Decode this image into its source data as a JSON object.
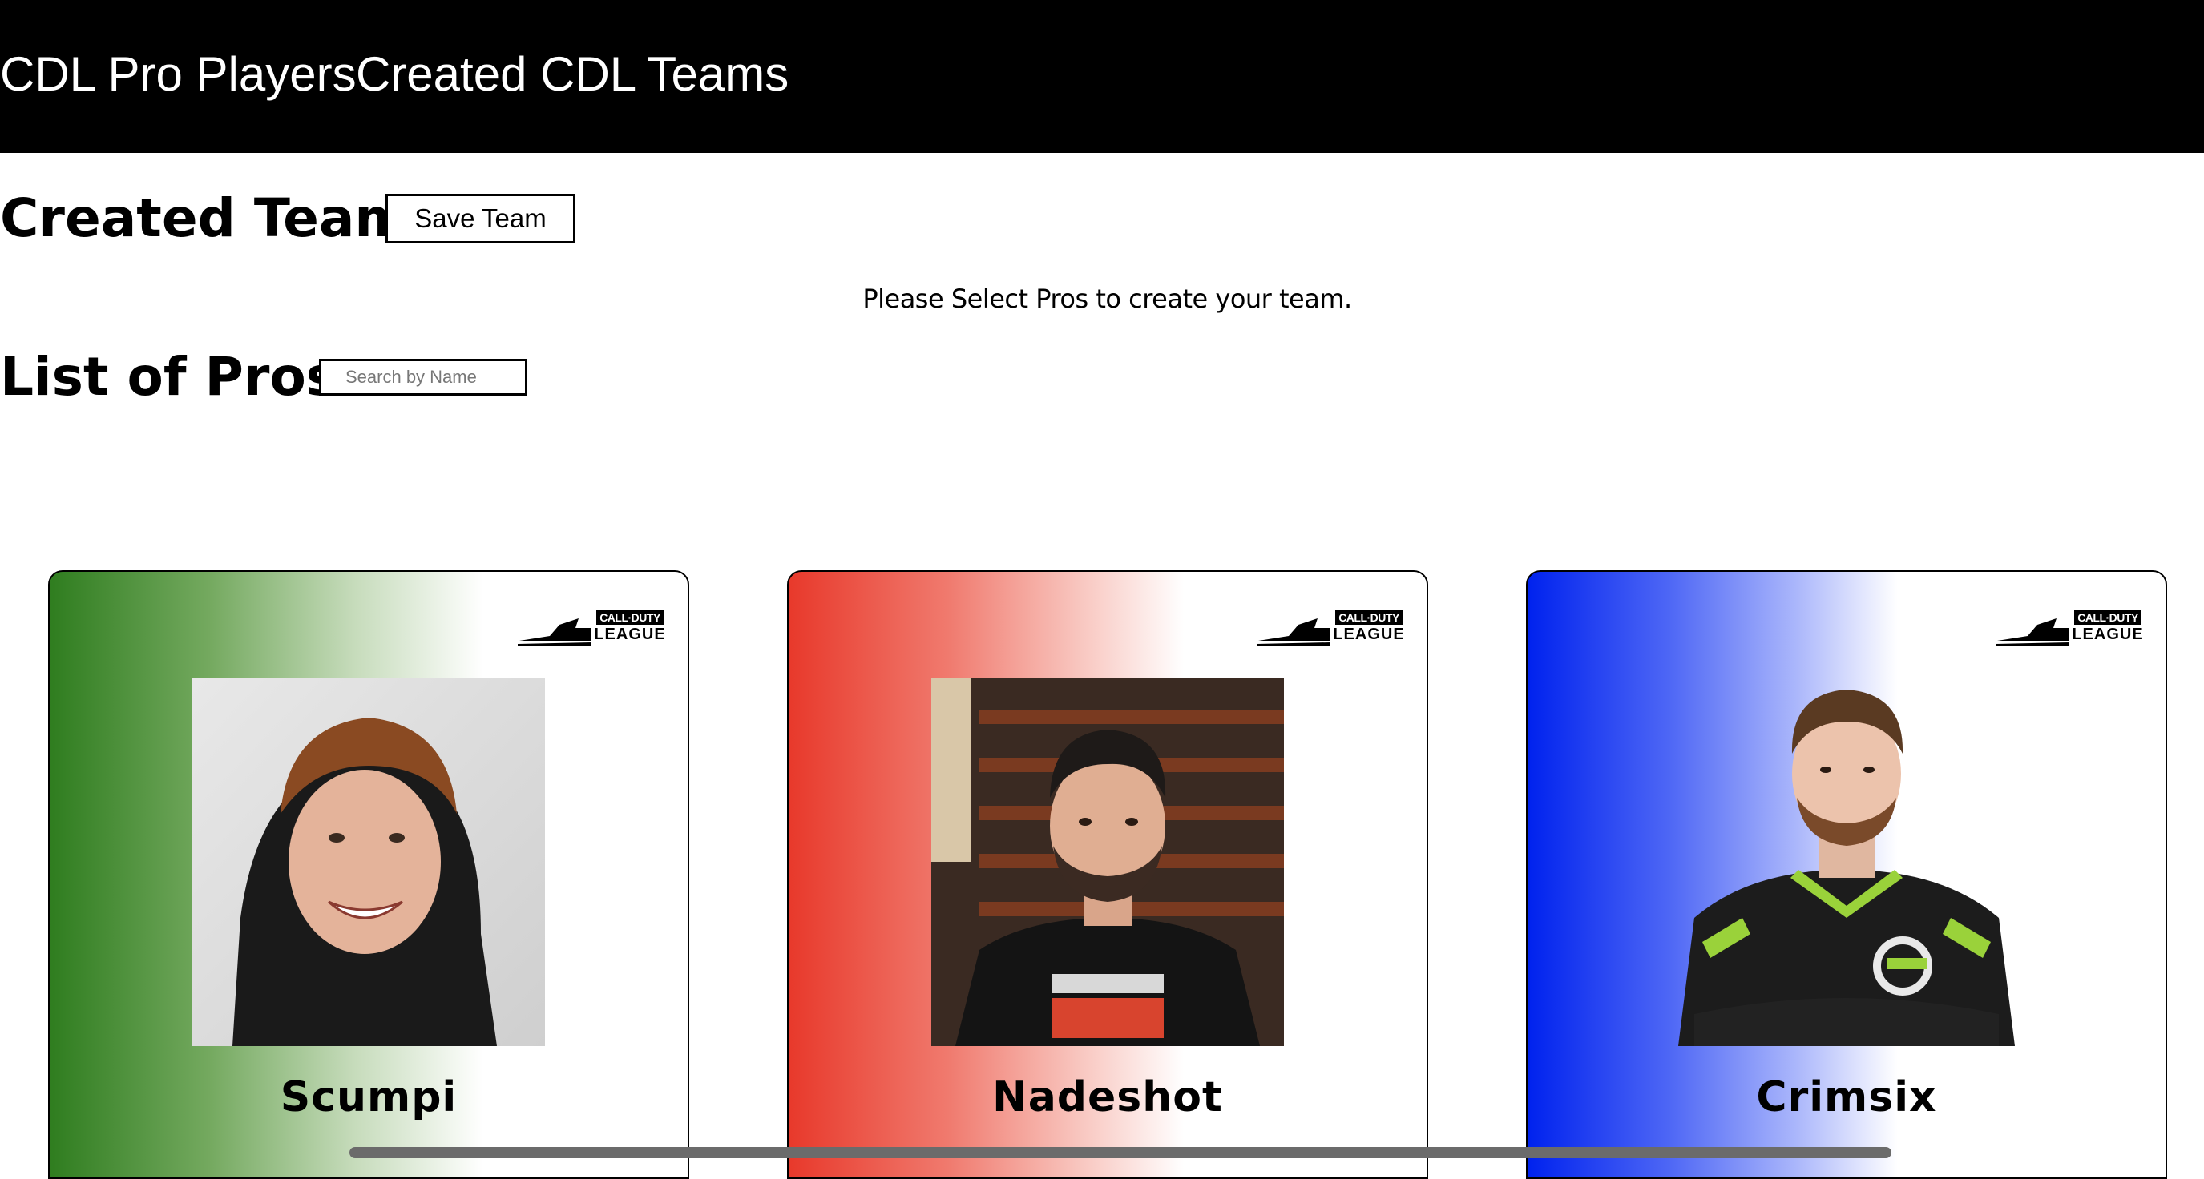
{
  "nav": {
    "links": [
      "CDL Pro Players",
      "Created CDL Teams"
    ],
    "background": "#000000",
    "text_color": "#ffffff"
  },
  "created_team": {
    "title": "Created Team",
    "save_label": "Save Team",
    "hint": "Please Select Pros to create your team."
  },
  "pros": {
    "title": "List of Pros",
    "search_placeholder": "Search by Name"
  },
  "logo": {
    "line1": "CALL·DUTY",
    "line2": "LEAGUE"
  },
  "players": [
    {
      "name": "Scumpi",
      "team_color": "#2f7d1f"
    },
    {
      "name": "Nadeshot",
      "team_color": "#e8392b"
    },
    {
      "name": "Crimsix",
      "team_color": "#0022ee"
    }
  ]
}
